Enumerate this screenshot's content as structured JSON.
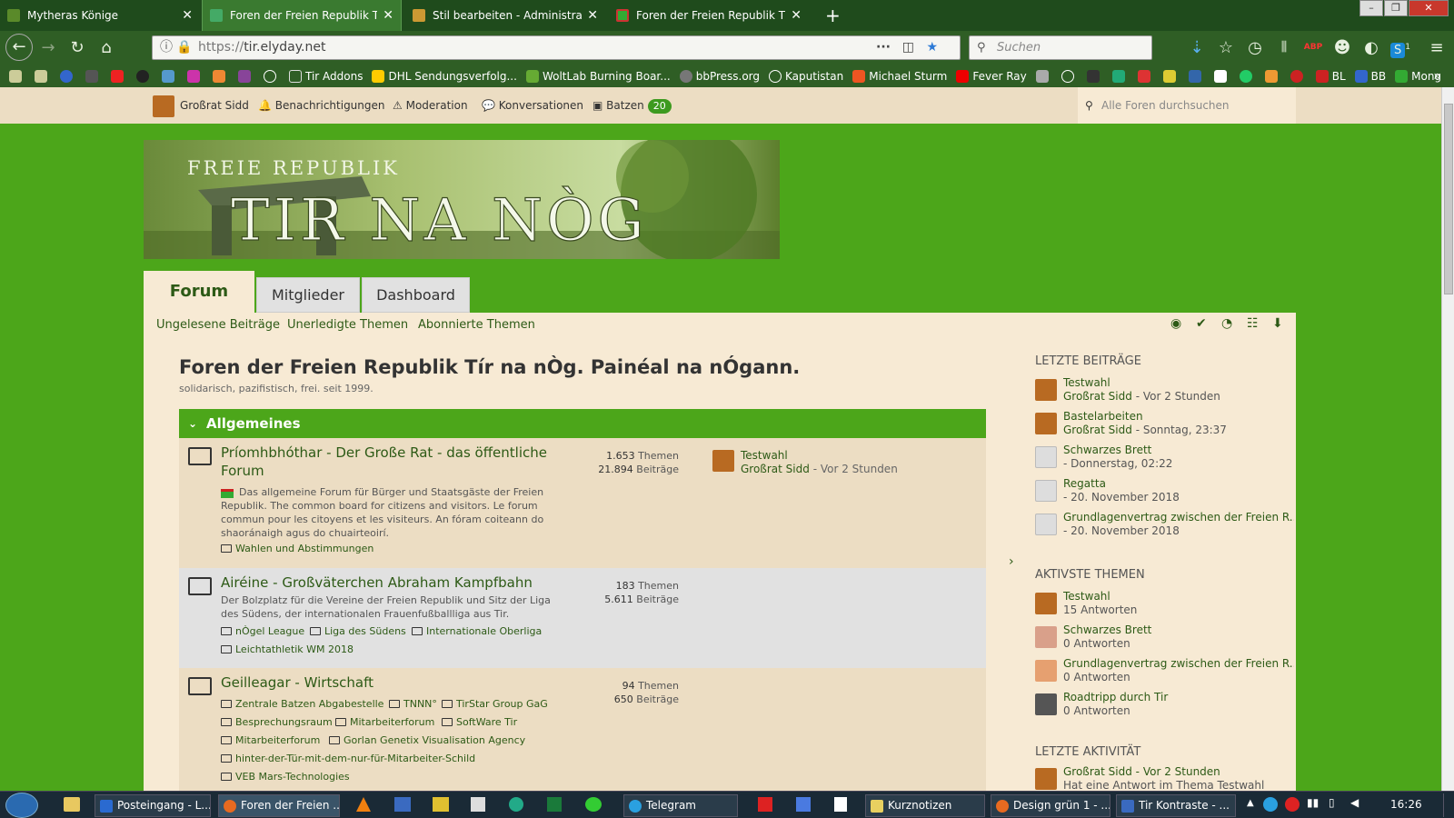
{
  "browser": {
    "tabs": [
      {
        "title": "Mytheras Könige"
      },
      {
        "title": "Foren der Freien Republik Tír na nÒg"
      },
      {
        "title": "Stil bearbeiten - Administration"
      },
      {
        "title": "Foren der Freien Republik Tír na nÒg"
      }
    ],
    "url": "https://tir.elyday.net",
    "url_host": "tir.elyday.net",
    "search_placeholder": "Suchen",
    "bookmarks": [
      "Tir Addons",
      "DHL Sendungsverfolg...",
      "WoltLab Burning Boar...",
      "bbPress.org",
      "Kaputistan",
      "Michael Sturm",
      "Fever Ray",
      "BL",
      "BB",
      "Mong"
    ],
    "toolbar_badge": "1"
  },
  "userbar": {
    "user": "Großrat Sidd",
    "notifications": "Benachrichtigungen",
    "moderation": "Moderation",
    "conversations": "Konversationen",
    "batzen": "Batzen",
    "batzen_count": "20",
    "search_placeholder": "Alle Foren durchsuchen"
  },
  "banner": {
    "line1": "FREIE REPUBLIK",
    "line2": "TIR NA NÒG"
  },
  "main_tabs": [
    "Forum",
    "Mitglieder",
    "Dashboard"
  ],
  "sublinks": [
    "Ungelesene Beiträge",
    "Unerledigte Themen",
    "Abonnierte Themen"
  ],
  "page": {
    "title": "Foren der Freien Republik Tír na nÒg. Painéal na nÓgann.",
    "subtitle": "solidarisch, pazifistisch, frei. seit 1999."
  },
  "category": {
    "title": "Allgemeines"
  },
  "forums": [
    {
      "title": "Príomhbhóthar - Der Große Rat - das öffentliche Forum",
      "desc": "Das allgemeine Forum für Bürger und Staatsgäste der Freien Republik. The common board for citizens and visitors. Le forum commun pour les citoyens et les visiteurs. An fóram coiteann do shaoránaigh agus do chuairteoirí.",
      "themes": "1.653",
      "posts": "21.894",
      "themes_label": "Themen",
      "posts_label": "Beiträge",
      "last_title": "Testwahl",
      "last_user": "Großrat Sidd",
      "last_time": "Vor 2 Stunden",
      "subforums": [
        "Wahlen und Abstimmungen"
      ]
    },
    {
      "title": "Airéine - Großväterchen Abraham Kampfbahn",
      "desc": "Der Bolzplatz für die Vereine der Freien Republik und Sitz der Liga des Südens, der internationalen Frauenfußballliga aus Tir.",
      "themes": "183",
      "posts": "5.611",
      "themes_label": "Themen",
      "posts_label": "Beiträge",
      "subforums": [
        "nÒgel League",
        "Liga des Südens",
        "Internationale Oberliga",
        "Leichtathletik WM 2018"
      ]
    },
    {
      "title": "Geilleagar - Wirtschaft",
      "themes": "94",
      "posts": "650",
      "themes_label": "Themen",
      "posts_label": "Beiträge",
      "subforums": [
        "Zentrale Batzen Abgabestelle",
        "TNNN°",
        "TirStar Group GaG",
        "Besprechungsraum",
        "Mitarbeiterforum",
        "SoftWare Tir",
        "Mitarbeiterforum",
        "Gorlan Genetix Visualisation Agency",
        "hinter-der-Tür-mit-dem-nur-für-Mitarbeiter-Schild",
        "VEB Mars-Technologies"
      ]
    }
  ],
  "sidebar": {
    "recent_posts_title": "LETZTE BEITRÄGE",
    "recent_posts": [
      {
        "title": "Testwahl",
        "user": "Großrat Sidd",
        "time": "- Vor 2 Stunden"
      },
      {
        "title": "Bastelarbeiten",
        "user": "Großrat Sidd",
        "time": "- Sonntag, 23:37"
      },
      {
        "title": "Schwarzes Brett",
        "user": "",
        "time": "- Donnerstag, 02:22"
      },
      {
        "title": "Regatta",
        "user": "",
        "time": "- 20. November 2018"
      },
      {
        "title": "Grundlagenvertrag zwischen der Freien R...",
        "user": "",
        "time": "- 20. November 2018"
      }
    ],
    "active_title": "AKTIVSTE THEMEN",
    "active": [
      {
        "title": "Testwahl",
        "meta": "15 Antworten"
      },
      {
        "title": "Schwarzes Brett",
        "meta": "0 Antworten"
      },
      {
        "title": "Grundlagenvertrag zwischen der Freien R...",
        "meta": "0 Antworten"
      },
      {
        "title": "Roadtripp durch Tir",
        "meta": "0 Antworten"
      }
    ],
    "activity_title": "LETZTE AKTIVITÄT",
    "activity": [
      {
        "title": "Großrat Sidd - Vor 2 Stunden",
        "meta": "Hat eine Antwort im Thema Testwahl"
      }
    ]
  },
  "taskbar": {
    "items": [
      "Posteingang - L...",
      "Foren der Freien ...",
      "Telegram",
      "Kurznotizen",
      "Design grün 1 - ...",
      "Tir Kontraste - ..."
    ],
    "clock": "16:26"
  },
  "colors": {
    "accent": "#4ca61a",
    "content_bg": "#f7ead4",
    "link": "#2d5a16"
  }
}
